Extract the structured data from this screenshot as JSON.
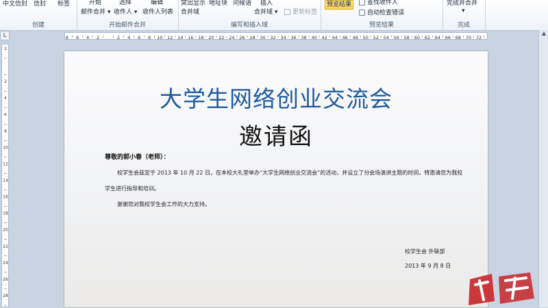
{
  "ribbon": {
    "groups": [
      {
        "label": "创建",
        "items": [
          "中文信封",
          "信封",
          "标签"
        ]
      },
      {
        "label": "开始邮件合并",
        "items": [
          "开始",
          "选择",
          "编辑",
          "邮件合并 ▾",
          "收件人 ▾",
          "收件人列表"
        ]
      },
      {
        "label": "编写和插入域",
        "items": [
          "突出显示",
          "地址块",
          "问候语",
          "插入",
          "合并域",
          "合并域 ▾",
          "更新标签"
        ]
      },
      {
        "label": "预览结果",
        "items": [
          "预览结果",
          "查找收件人",
          "自动检查错误"
        ]
      },
      {
        "label": "完成",
        "items": [
          "完成并合并",
          "▾"
        ]
      }
    ],
    "preview_label": "预览结果"
  },
  "ruler": {
    "corner": "L",
    "h_ticks": [
      "8",
      "6",
      "4",
      "2",
      "",
      "2",
      "4",
      "6",
      "8",
      "10",
      "12",
      "14",
      "16",
      "18",
      "20",
      "22",
      "24",
      "26",
      "28",
      "30",
      "32",
      "34",
      "36",
      "38",
      "40",
      "42",
      "44",
      "46",
      "48",
      "50",
      "52",
      "54",
      "56",
      "58",
      "60",
      "62",
      "64",
      "66",
      "68",
      "70",
      "72"
    ],
    "v_ticks": [
      "2",
      "",
      "2",
      "4",
      "6",
      "8",
      "10",
      "12",
      "14",
      "16",
      "18",
      "20",
      "22",
      "24",
      "26",
      "28"
    ]
  },
  "document": {
    "title": "大学生网络创业交流会",
    "subtitle": "邀请函",
    "salutation": "尊敬的郭小春（老师）：",
    "body_line1": "校学生会兹定于 2013 年 10 月 22 日，在本校大礼堂举办“大学生网络创业交流会”的活动，并设立了分会场演讲主题的时间，特邀请您为我校",
    "body_line2": "学生进行指导和培训。",
    "body_line3": "谢谢您对我校学生会工作的大力支持。",
    "sign_org": "校学生会 外联部",
    "sign_date": "2013 年 9 月 8 日"
  },
  "colors": {
    "title": "#1f5a9e",
    "logo": "#c8262a"
  }
}
